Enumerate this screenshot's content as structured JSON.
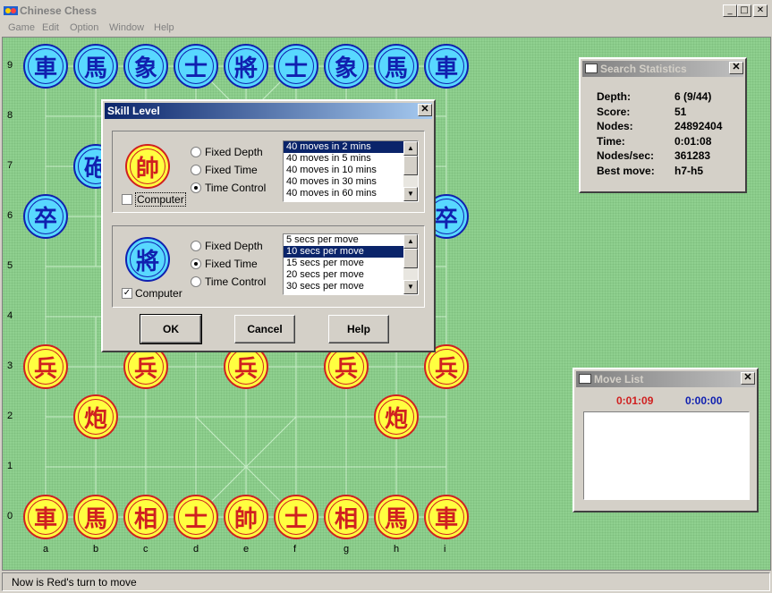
{
  "window": {
    "title": "Chinese Chess",
    "minimize": "_",
    "maximize": "□",
    "close": "✕"
  },
  "menu": [
    "Game",
    "Edit",
    "Option",
    "Window",
    "Help"
  ],
  "ranks": [
    "9",
    "8",
    "7",
    "6",
    "5",
    "4",
    "3",
    "2",
    "1",
    "0"
  ],
  "files": [
    "a",
    "b",
    "c",
    "d",
    "e",
    "f",
    "g",
    "h",
    "i"
  ],
  "pieces": [
    {
      "side": "black",
      "char": "車",
      "file": "a",
      "rank": "9"
    },
    {
      "side": "black",
      "char": "馬",
      "file": "b",
      "rank": "9"
    },
    {
      "side": "black",
      "char": "象",
      "file": "c",
      "rank": "9"
    },
    {
      "side": "black",
      "char": "士",
      "file": "d",
      "rank": "9"
    },
    {
      "side": "black",
      "char": "將",
      "file": "e",
      "rank": "9"
    },
    {
      "side": "black",
      "char": "士",
      "file": "f",
      "rank": "9"
    },
    {
      "side": "black",
      "char": "象",
      "file": "g",
      "rank": "9"
    },
    {
      "side": "black",
      "char": "馬",
      "file": "h",
      "rank": "9"
    },
    {
      "side": "black",
      "char": "車",
      "file": "i",
      "rank": "9"
    },
    {
      "side": "black",
      "char": "砲",
      "file": "b",
      "rank": "7"
    },
    {
      "side": "black",
      "char": "卒",
      "file": "a",
      "rank": "6"
    },
    {
      "side": "black",
      "char": "卒",
      "file": "i",
      "rank": "6"
    },
    {
      "side": "red",
      "char": "兵",
      "file": "a",
      "rank": "3"
    },
    {
      "side": "red",
      "char": "兵",
      "file": "c",
      "rank": "3"
    },
    {
      "side": "red",
      "char": "兵",
      "file": "e",
      "rank": "3"
    },
    {
      "side": "red",
      "char": "兵",
      "file": "g",
      "rank": "3"
    },
    {
      "side": "red",
      "char": "兵",
      "file": "i",
      "rank": "3"
    },
    {
      "side": "red",
      "char": "炮",
      "file": "b",
      "rank": "2"
    },
    {
      "side": "red",
      "char": "炮",
      "file": "h",
      "rank": "2"
    },
    {
      "side": "red",
      "char": "車",
      "file": "a",
      "rank": "0"
    },
    {
      "side": "red",
      "char": "馬",
      "file": "b",
      "rank": "0"
    },
    {
      "side": "red",
      "char": "相",
      "file": "c",
      "rank": "0"
    },
    {
      "side": "red",
      "char": "士",
      "file": "d",
      "rank": "0"
    },
    {
      "side": "red",
      "char": "帥",
      "file": "e",
      "rank": "0"
    },
    {
      "side": "red",
      "char": "士",
      "file": "f",
      "rank": "0"
    },
    {
      "side": "red",
      "char": "相",
      "file": "g",
      "rank": "0"
    },
    {
      "side": "red",
      "char": "馬",
      "file": "h",
      "rank": "0"
    },
    {
      "side": "red",
      "char": "車",
      "file": "i",
      "rank": "0"
    }
  ],
  "skill_dialog": {
    "title": "Skill Level",
    "red": {
      "piece_char": "帥",
      "options": [
        "Fixed Depth",
        "Fixed Time",
        "Time Control"
      ],
      "selected_option": "Time Control",
      "computer_label": "Computer",
      "computer_checked": false,
      "list": [
        "40 moves in 2 mins",
        "40 moves in 5 mins",
        "40 moves in 10 mins",
        "40 moves in 30 mins",
        "40 moves in 60 mins"
      ],
      "list_selected": "40 moves in 2 mins"
    },
    "black": {
      "piece_char": "將",
      "options": [
        "Fixed Depth",
        "Fixed Time",
        "Time Control"
      ],
      "selected_option": "Fixed Time",
      "computer_label": "Computer",
      "computer_checked": true,
      "list": [
        "5 secs per move",
        "10 secs per move",
        "15 secs per move",
        "20 secs per move",
        "30 secs per move"
      ],
      "list_selected": "10 secs per move"
    },
    "buttons": {
      "ok": "OK",
      "cancel": "Cancel",
      "help": "Help"
    }
  },
  "search_stats": {
    "title": "Search Statistics",
    "rows": [
      {
        "label": "Depth:",
        "value": "6  (9/44)"
      },
      {
        "label": "Score:",
        "value": "51"
      },
      {
        "label": "Nodes:",
        "value": "24892404"
      },
      {
        "label": "Time:",
        "value": "0:01:08"
      },
      {
        "label": "Nodes/sec:",
        "value": "361283"
      },
      {
        "label": "Best move:",
        "value": "h7-h5"
      }
    ]
  },
  "move_list": {
    "title": "Move List",
    "red_time": "0:01:09",
    "black_time": "0:00:00"
  },
  "status": "Now is Red's turn to move",
  "colors": {
    "board": "#8fd08f",
    "red_piece_fill": "#ffff40",
    "red_piece_ink": "#d02020",
    "black_piece_fill": "#58d8ff",
    "black_piece_ink": "#1020b0",
    "red_timer": "#d02020",
    "black_timer": "#1020b0"
  }
}
